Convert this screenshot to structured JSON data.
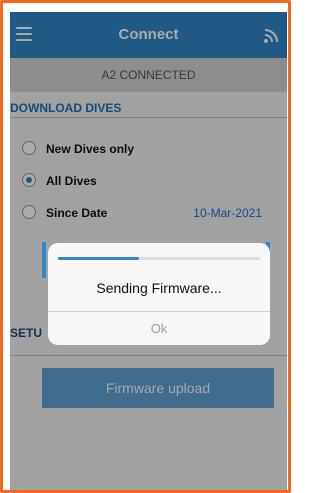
{
  "header": {
    "title": "Connect",
    "menu_icon": "hamburger-menu-icon",
    "signal_icon": "wireless-signal-icon"
  },
  "status": {
    "connection": "A2 CONNECTED"
  },
  "download": {
    "section_title": "DOWNLOAD DIVES",
    "options": [
      {
        "label": "New Dives only",
        "selected": false
      },
      {
        "label": "All Dives",
        "selected": true
      },
      {
        "label": "Since Date",
        "selected": false,
        "date": "10-Mar-2021"
      }
    ]
  },
  "setup": {
    "section_title": "SETU",
    "firmware_button": "Firmware upload"
  },
  "dialog": {
    "message": "Sending Firmware...",
    "ok_label": "Ok",
    "progress": 0.4
  },
  "colors": {
    "accent": "#2f86c9",
    "frame": "#f26a1b",
    "section_title": "#1f71bd"
  }
}
